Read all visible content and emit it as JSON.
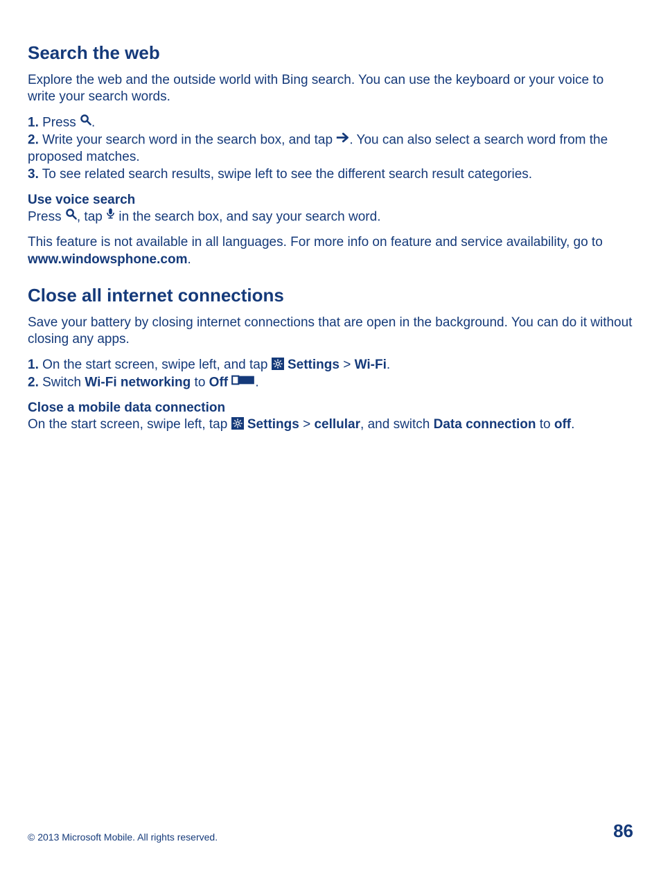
{
  "section1": {
    "heading": "Search the web",
    "intro": "Explore the web and the outside world with Bing search. You can use the keyboard or your voice to write your search words.",
    "step1_num": "1.",
    "step1_a": " Press ",
    "step1_b": ".",
    "step2_num": "2.",
    "step2_a": " Write your search word in the search box, and tap ",
    "step2_b": ". You can also select a search word from the proposed matches.",
    "step3_num": "3.",
    "step3_a": " To see related search results, swipe left to see the different search result categories.",
    "sub_heading": "Use voice search",
    "voice_a": "Press ",
    "voice_b": ", tap ",
    "voice_c": " in the search box, and say your search word.",
    "avail_a": "This feature is not available in all languages. For more info on feature and service availability, go to ",
    "avail_link": "www.windowsphone.com",
    "avail_b": "."
  },
  "section2": {
    "heading": "Close all internet connections",
    "intro": "Save your battery by closing internet connections that are open in the background. You can do it without closing any apps.",
    "step1_num": "1.",
    "step1_a": " On the start screen, swipe left, and tap ",
    "settings_label": "Settings",
    "gt": " > ",
    "wifi_label": "Wi-Fi",
    "step1_end": ".",
    "step2_num": "2.",
    "step2_a": " Switch ",
    "wifi_net": "Wi-Fi networking",
    "step2_b": " to ",
    "off_label": "Off",
    "step2_end": " ",
    "step2_dot": ".",
    "sub_heading": "Close a mobile data connection",
    "mob_a": "On the start screen, swipe left, tap ",
    "cellular_label": "cellular",
    "mob_b": ", and switch ",
    "data_conn": "Data connection",
    "mob_c": " to ",
    "off2": "off",
    "mob_end": "."
  },
  "footer": {
    "copyright": "© 2013 Microsoft Mobile. All rights reserved.",
    "page": "86"
  }
}
